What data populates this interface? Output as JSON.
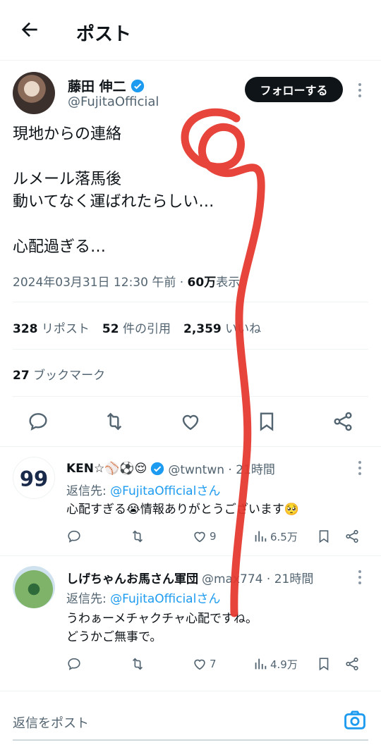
{
  "header": {
    "title": "ポスト"
  },
  "post": {
    "author_name": "藤田 伸二",
    "author_handle": "@FujitaOfficial",
    "follow_label": "フォローする",
    "text": "現地からの連絡\n\nルメール落馬後\n動いてなく運ばれたらしい…\n\n心配過ぎる…",
    "timestamp": "2024年03月31日 12:30 午前 · ",
    "views_count": "60万",
    "views_label": "表示",
    "reposts_count": "328",
    "reposts_label": "リポスト",
    "quotes_count": "52",
    "quotes_label": "件の引用",
    "likes_count": "2,359",
    "likes_label": "いいね",
    "bookmarks_count": "27",
    "bookmarks_label": "ブックマーク"
  },
  "replies": [
    {
      "name": "KEN☆⚾⚽😌",
      "handle": "@twntwn · 21時間",
      "reply_to_prefix": "返信先: ",
      "reply_to": "@FujitaOfficialさん",
      "text": "心配すぎる😭情報ありがとうございます🥺",
      "likes": "9",
      "views": "6.5万"
    },
    {
      "name": "しげちゃんお馬さん軍団",
      "handle": "@max774 · 21時間",
      "reply_to_prefix": "返信先: ",
      "reply_to": "@FujitaOfficialさん",
      "text": "うわぁーメチャクチャ心配ですね。\nどうかご無事で。",
      "likes": "7",
      "views": "4.9万"
    }
  ],
  "compose": {
    "placeholder": "返信をポスト"
  },
  "colors": {
    "accent": "#1d9bf0",
    "text": "#0f1419",
    "muted": "#536471",
    "scribble": "#e5352b"
  },
  "icons": [
    "back-arrow-icon",
    "verified-badge-icon",
    "more-icon",
    "reply-icon",
    "repost-icon",
    "like-icon",
    "bookmark-icon",
    "share-icon",
    "views-icon",
    "camera-icon"
  ]
}
